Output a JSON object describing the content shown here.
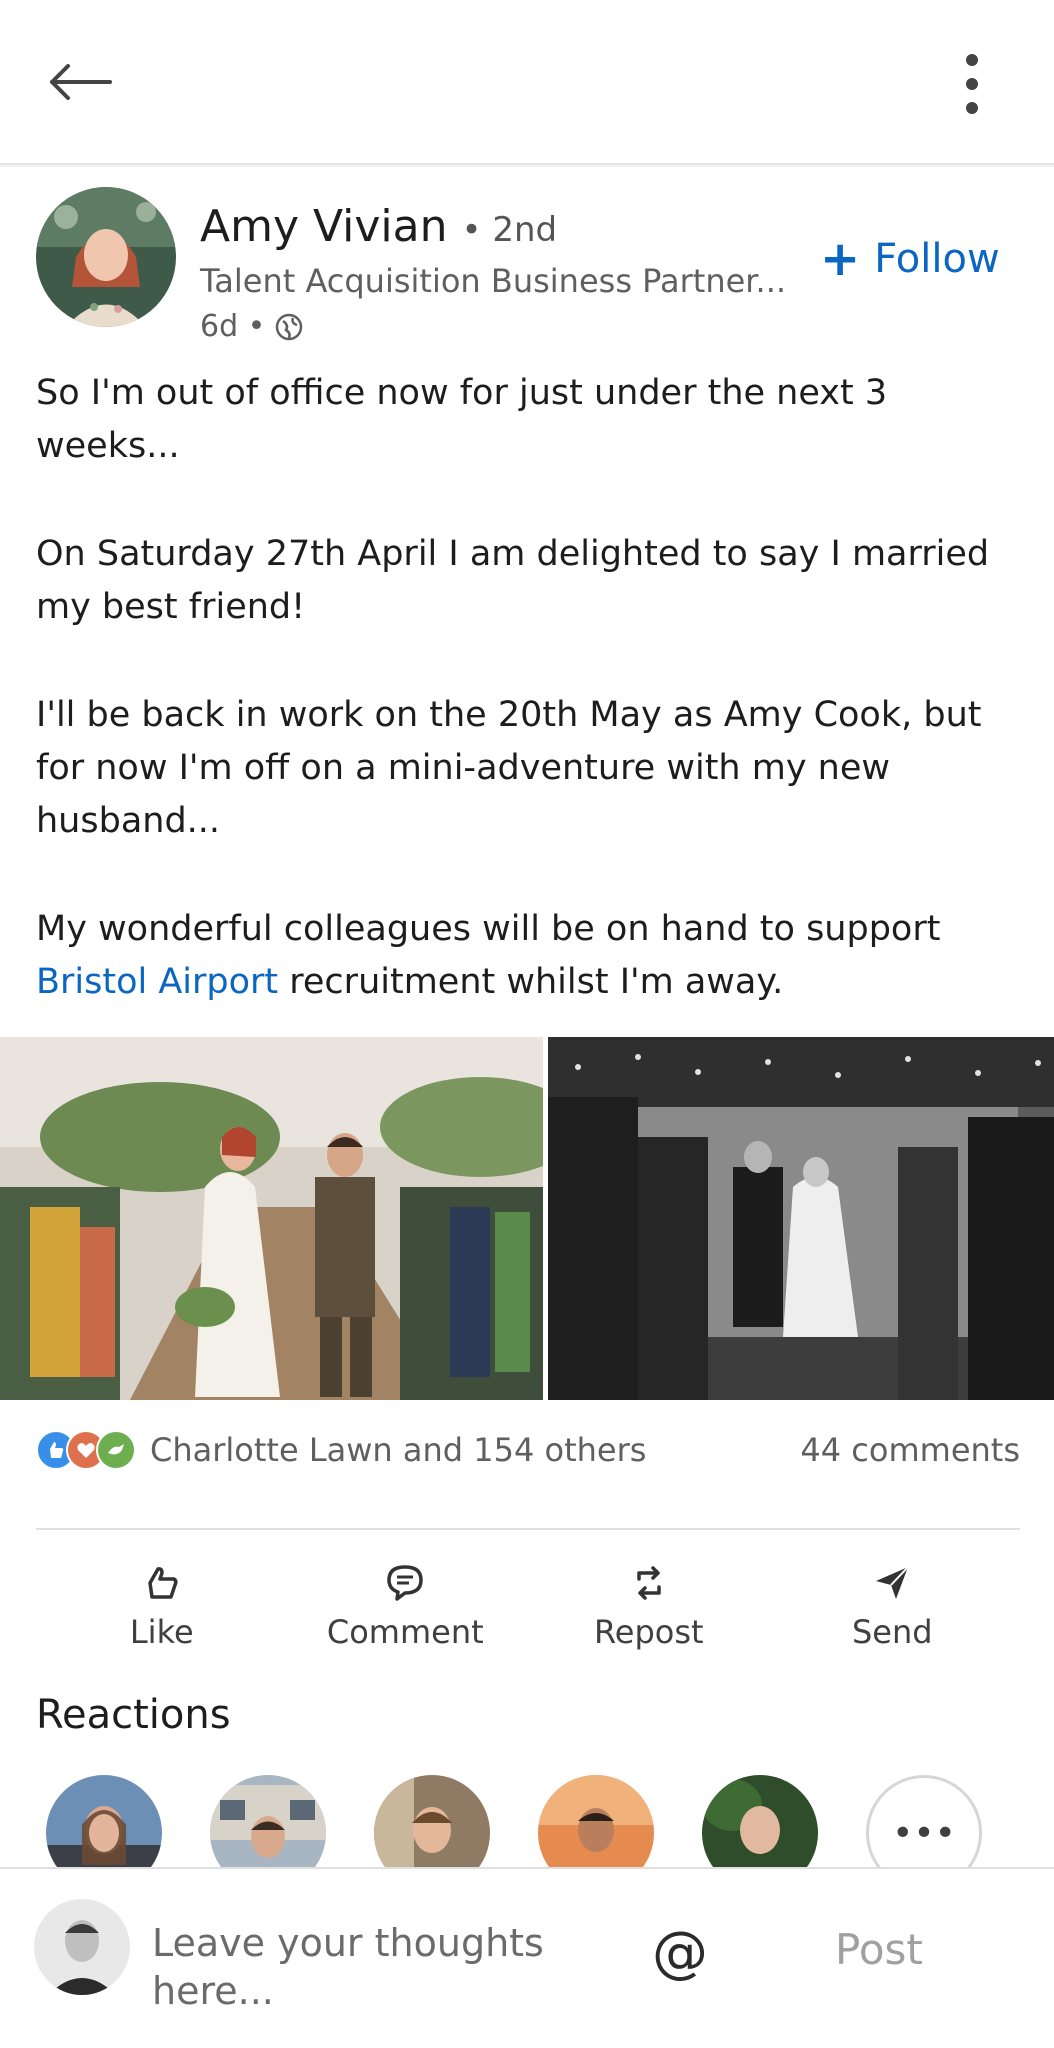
{
  "post": {
    "author_name": "Amy Vivian",
    "degree": "• 2nd",
    "headline": "Talent Acquisition Business Partner...",
    "time_ago": "6d •",
    "follow_label": "Follow",
    "follow_plus": "+",
    "body": {
      "p1": "So I'm out of office now for just under the next 3 weeks...",
      "p2": "On Saturday 27th April I am delighted to say I married my best friend!",
      "p3": "I'll be back in work on the 20th May as Amy Cook, but for now I'm off on a mini-adventure with my new husband...",
      "p4_before": "My wonderful colleagues will be on hand to support ",
      "p4_mention": "Bristol Airport",
      "p4_after": " recruitment whilst I'm away."
    }
  },
  "social": {
    "reactions_text": "Charlotte Lawn and 154 others",
    "comments_text": "44 comments",
    "reaction_icons": [
      "like-icon",
      "love-icon",
      "support-icon"
    ]
  },
  "actions": {
    "like": "Like",
    "comment": "Comment",
    "repost": "Repost",
    "send": "Send"
  },
  "reactions_section": {
    "heading": "Reactions",
    "more_label": "•••"
  },
  "composer": {
    "placeholder": "Leave your thoughts here...",
    "mention_symbol": "@",
    "post_label": "Post"
  },
  "colors": {
    "accent": "#0a66c2",
    "text_primary": "#1d1d1d",
    "text_secondary": "#5f5f5f"
  }
}
